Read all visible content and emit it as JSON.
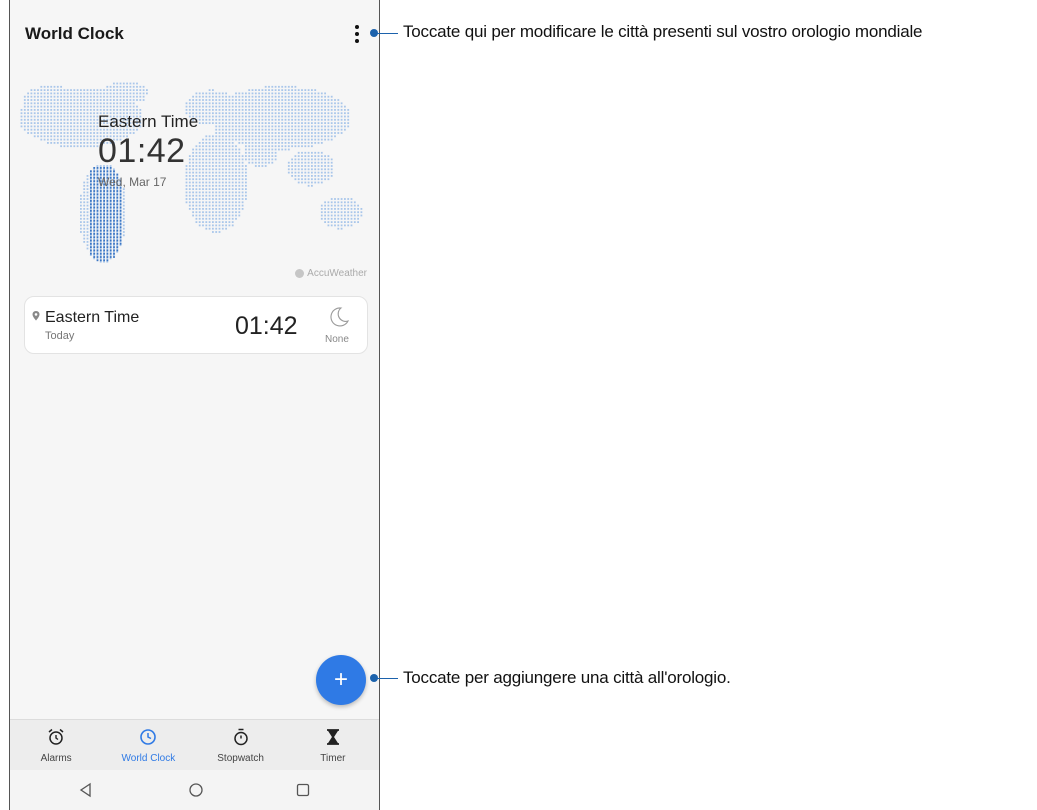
{
  "app": {
    "title": "World Clock"
  },
  "map": {
    "city": "Eastern Time",
    "time": "01:42",
    "date": "Wed, Mar 17",
    "provider": "AccuWeather"
  },
  "clock_list": [
    {
      "city": "Eastern Time",
      "day": "Today",
      "time": "01:42",
      "weather": "None",
      "icon": "moon-icon"
    }
  ],
  "fab": {
    "label": "+"
  },
  "tabs": [
    {
      "label": "Alarms",
      "icon": "alarm-icon",
      "active": false
    },
    {
      "label": "World Clock",
      "icon": "clock-icon",
      "active": true
    },
    {
      "label": "Stopwatch",
      "icon": "stopwatch-icon",
      "active": false
    },
    {
      "label": "Timer",
      "icon": "hourglass-icon",
      "active": false
    }
  ],
  "system_nav": [
    "back-icon",
    "home-icon",
    "recents-icon"
  ],
  "callouts": {
    "menu": "Toccate qui per modificare le città presenti sul vostro orologio mondiale",
    "add": "Toccate per aggiungere una città all'orologio."
  },
  "colors": {
    "accent": "#2f7ae5",
    "callout": "#1c62ac",
    "map_dots": "#a9c6ea"
  }
}
